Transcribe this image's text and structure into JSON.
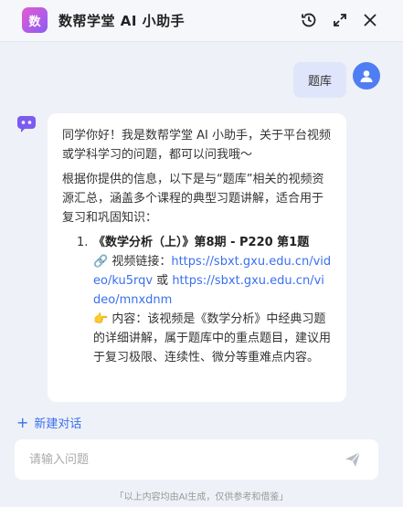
{
  "header": {
    "logo_text": "数",
    "title": "数帮学堂 AI 小助手",
    "icons": [
      "history-icon",
      "expand-icon",
      "close-icon"
    ]
  },
  "user_message": {
    "text": "题库"
  },
  "bot_message": {
    "greeting": "同学你好！我是数帮学堂 AI 小助手，关于平台视频或学科学习的问题，都可以问我哦～",
    "intro": "根据你提供的信息，以下是与“题库”相关的视频资源汇总，涵盖多个课程的典型习题讲解，适合用于复习和巩固知识：",
    "items": [
      {
        "number": "1.",
        "title": "《数学分析（上）》第8期 - P220 第1题",
        "link_label": "🔗 视频链接：",
        "link1": "https://sbxt.gxu.edu.cn/video/ku5rqv",
        "link_or": " 或 ",
        "link2": "https://sbxt.gxu.edu.cn/video/mnxdnm",
        "content": "👉 内容：该视频是《数学分析》中经典习题的详细讲解，属于题库中的重点题目，建议用于复习极限、连续性、微分等重难点内容。"
      }
    ]
  },
  "actions": {
    "new_chat_icon": "+",
    "new_chat_label": "新建对话"
  },
  "input": {
    "placeholder": "请输入问题",
    "value": ""
  },
  "footer": {
    "note": "「以上内容均由AI生成，仅供参考和借鉴」"
  },
  "colors": {
    "accent": "#3a6ff0",
    "user_bubble": "#dfe6fb",
    "background": "#eef1f7"
  }
}
